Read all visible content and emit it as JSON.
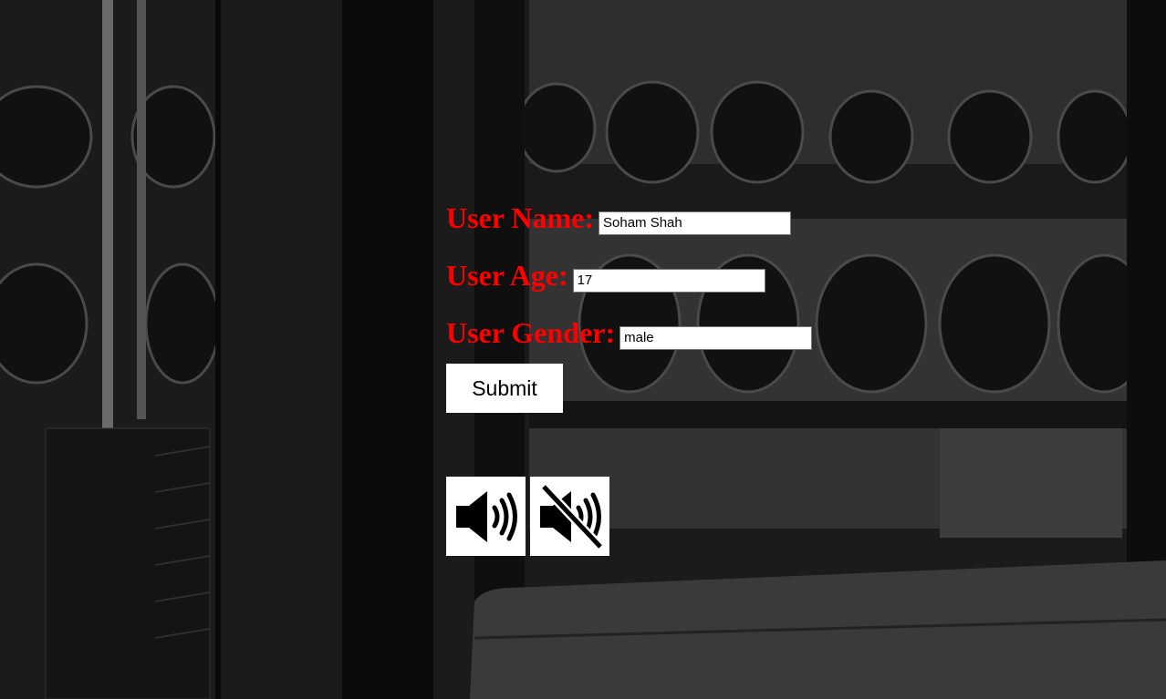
{
  "form": {
    "username_label": "User Name:",
    "username_value": "Soham Shah",
    "age_label": "User Age:",
    "age_value": "17",
    "gender_label": "User Gender:",
    "gender_value": "male",
    "submit_label": "Submit"
  },
  "audio": {
    "play_icon": "speaker-on-icon",
    "mute_icon": "speaker-muted-icon"
  },
  "colors": {
    "label": "#ff0000",
    "button_bg": "#ffffff"
  }
}
